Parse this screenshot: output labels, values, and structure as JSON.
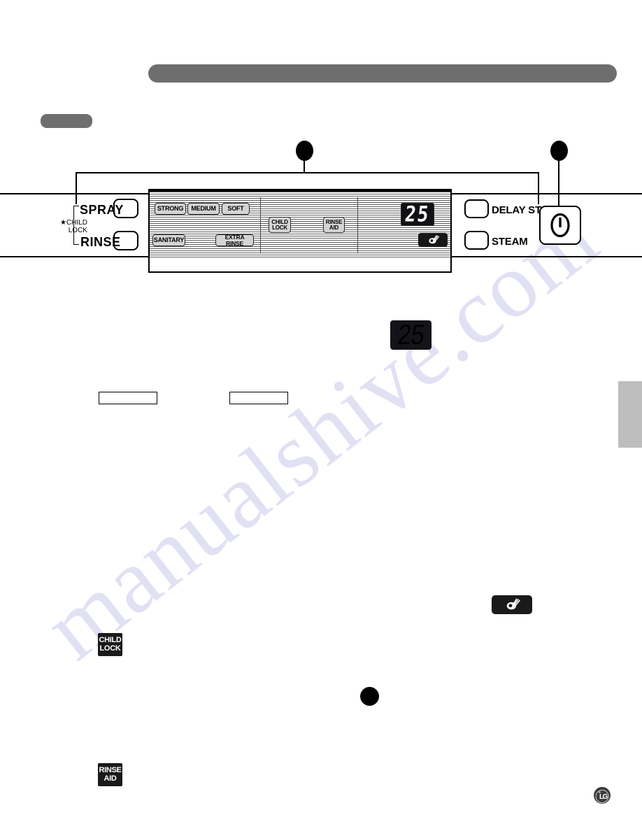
{
  "page": {
    "watermark": "manualshive.com",
    "brand_logo": "lg-logo"
  },
  "control_panel": {
    "left_controls": [
      {
        "label": "SPRAY",
        "button": "spray-button"
      },
      {
        "label": "RINSE",
        "button": "rinse-button"
      }
    ],
    "child_lock_note": {
      "line1": "★CHILD",
      "line2": "LOCK"
    },
    "right_controls": [
      {
        "label": "DELAY START",
        "button": "delay-start-button"
      },
      {
        "label": "STEAM",
        "button": "steam-button"
      }
    ],
    "power_button": {
      "name": "power-button",
      "icon": "power-icon"
    },
    "indicator_chips": [
      {
        "name": "strong-indicator",
        "label": "STRONG"
      },
      {
        "name": "medium-indicator",
        "label": "MEDIUM"
      },
      {
        "name": "soft-indicator",
        "label": "SOFT"
      },
      {
        "name": "sanitary-indicator",
        "label": "SANITARY"
      },
      {
        "name": "extra-rinse-indicator",
        "label": "EXTRA RINSE"
      }
    ],
    "status_chips": [
      {
        "name": "child-lock-indicator",
        "line1": "CHILD",
        "line2": "LOCK"
      },
      {
        "name": "rinse-aid-indicator",
        "line1": "RINSE",
        "line2": "AID"
      }
    ],
    "display": {
      "name": "time-display",
      "value": "25"
    },
    "dish_icon": {
      "name": "clean-dish-icon"
    }
  },
  "figures": {
    "display_figure": {
      "name": "time-display-figure",
      "value": "25"
    },
    "dish_icon_figure": {
      "name": "clean-dish-icon-figure"
    },
    "child_lock_badge": {
      "name": "child-lock-badge",
      "line1": "CHILD",
      "line2": "LOCK"
    },
    "rinse_aid_badge": {
      "name": "rinse-aid-badge",
      "line1": "RINSE",
      "line2": "AID"
    },
    "blank_box_left": {
      "name": "blank-callout-box-left"
    },
    "blank_box_right": {
      "name": "blank-callout-box-right"
    }
  },
  "callouts": [
    {
      "name": "callout-marker-panel"
    },
    {
      "name": "callout-marker-power"
    },
    {
      "name": "callout-marker-body"
    }
  ],
  "colors": {
    "bar_gray": "#6e6e6e",
    "side_tab_gray": "#bdbdbd",
    "chip_gray": "#d4d4d4",
    "display_black": "#111114",
    "watermark_blue": "#c9c9ec"
  }
}
